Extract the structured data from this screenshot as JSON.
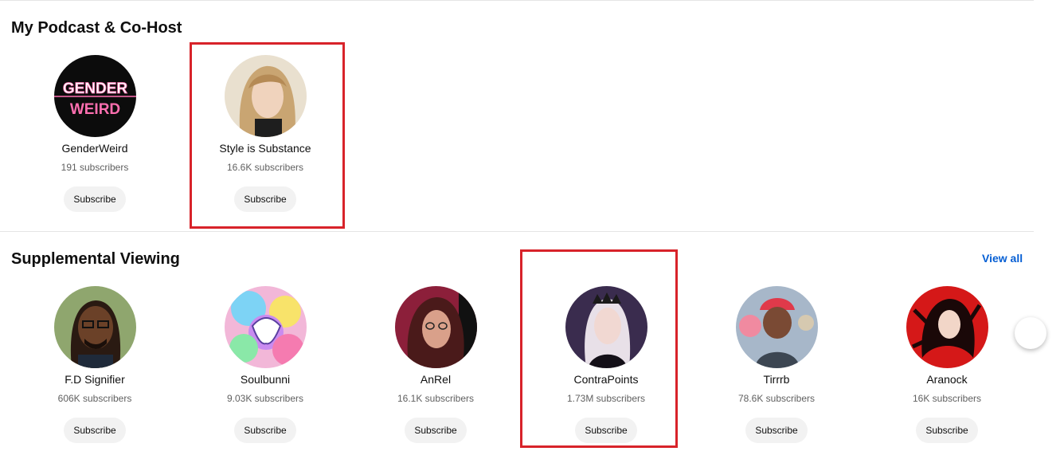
{
  "sections": [
    {
      "title": "My Podcast & Co-Host",
      "channels": [
        {
          "name": "GenderWeird",
          "subscribers": "191 subscribers",
          "button": "Subscribe",
          "avatar_icon": "genderweird-logo-icon",
          "avatar_text_1": "GENDER",
          "avatar_text_2": "WEIRD",
          "avatar_colors": {
            "bg": "#0c0c0c",
            "text": "#ff6fb0"
          }
        },
        {
          "name": "Style is Substance",
          "subscribers": "16.6K subscribers",
          "button": "Subscribe",
          "avatar_icon": "person-portrait-icon",
          "highlighted": true,
          "avatar_colors": {
            "bg": "#e9e0cf",
            "hair": "#c9a572",
            "skin": "#f0d3bd"
          }
        }
      ]
    },
    {
      "title": "Supplemental Viewing",
      "link": "View all",
      "channels": [
        {
          "name": "F.D Signifier",
          "subscribers": "606K subscribers",
          "button": "Subscribe",
          "avatar_icon": "illustrated-man-icon",
          "avatar_colors": {
            "bg": "#8fa66e",
            "skin": "#6b4128"
          }
        },
        {
          "name": "Soulbunni",
          "subscribers": "9.03K subscribers",
          "button": "Subscribe",
          "avatar_icon": "colorful-art-icon",
          "avatar_colors": {
            "bg": "#f2b7d8"
          }
        },
        {
          "name": "AnRel",
          "subscribers": "16.1K subscribers",
          "button": "Subscribe",
          "avatar_icon": "person-portrait-icon",
          "avatar_colors": {
            "bg": "#8c1f3a",
            "hair": "#4a1a1a",
            "skin": "#d9a08a"
          }
        },
        {
          "name": "ContraPoints",
          "subscribers": "1.73M subscribers",
          "button": "Subscribe",
          "avatar_icon": "person-portrait-icon",
          "highlighted": true,
          "avatar_colors": {
            "bg": "#3a2c4e",
            "hair": "#e8e0e8",
            "skin": "#f1d8d2"
          }
        },
        {
          "name": "Tirrrb",
          "subscribers": "78.6K subscribers",
          "button": "Subscribe",
          "avatar_icon": "illustrated-character-icon",
          "avatar_colors": {
            "bg": "#a7b7c9",
            "hair": "#e03a4a",
            "skin": "#7a4a34"
          }
        },
        {
          "name": "Aranock",
          "subscribers": "16K subscribers",
          "button": "Subscribe",
          "avatar_icon": "red-illustration-icon",
          "avatar_colors": {
            "bg": "#d51818"
          }
        }
      ]
    }
  ],
  "colors": {
    "highlight": "#d8232a",
    "link": "#065fd4",
    "button_bg": "#f2f2f2",
    "secondary_text": "#606060"
  },
  "carousel": {
    "next_icon": "chevron-right-icon"
  }
}
